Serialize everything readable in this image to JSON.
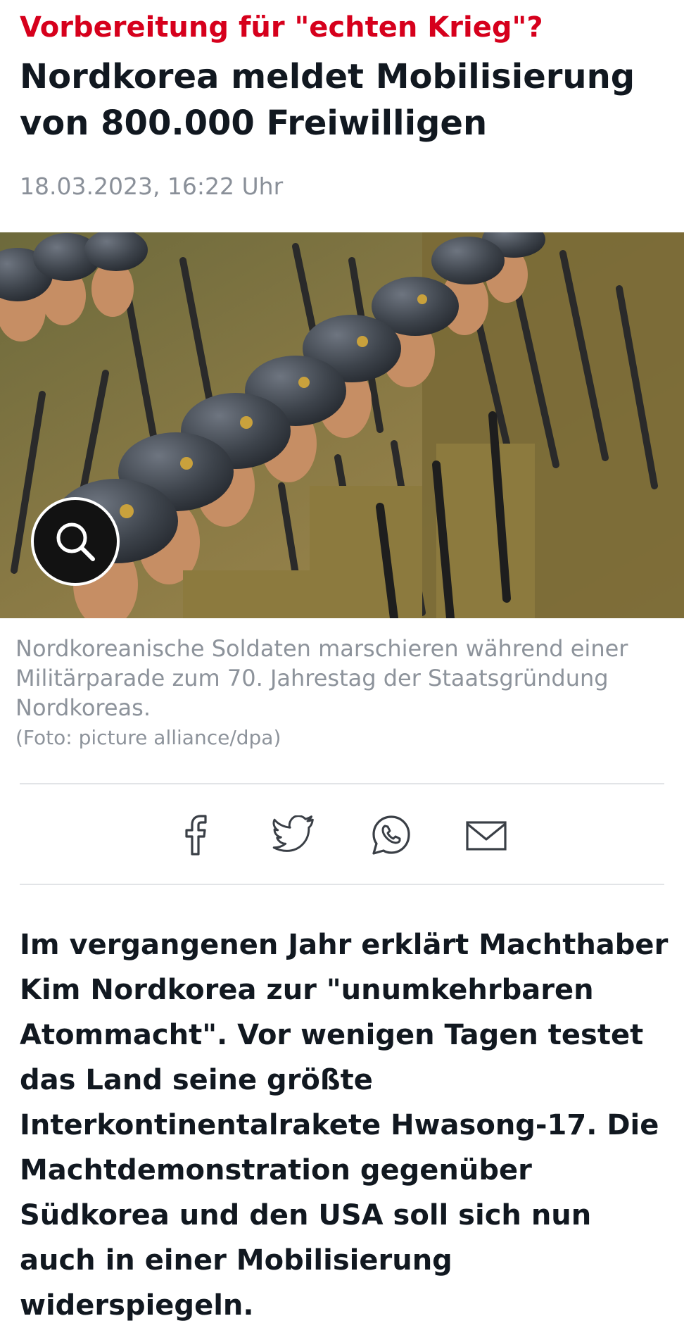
{
  "colors": {
    "accent": "#d6001c",
    "text": "#111820",
    "muted": "#8d939b"
  },
  "article": {
    "kicker": "Vorbereitung für \"echten Krieg\"?",
    "headline": "Nordkorea meldet Mobilisierung von 800.000 Freiwilligen",
    "timestamp": "18.03.2023, 16:22 Uhr"
  },
  "hero": {
    "image": "soldiers-marching-photo",
    "zoom_icon": "magnifier-icon"
  },
  "caption": {
    "text": "Nordkoreanische Soldaten marschieren während einer Militärparade zum 70. Jahrestag der Staatsgründung Nordkoreas.",
    "credit": "(Foto: picture alliance/dpa)"
  },
  "share": {
    "icons": [
      "facebook-icon",
      "twitter-icon",
      "whatsapp-icon",
      "email-icon"
    ]
  },
  "lead": "Im vergangenen Jahr erklärt Machthaber Kim Nordkorea zur \"unumkehrbaren Atommacht\". Vor wenigen Tagen testet das Land seine größte Interkontinentalrakete Hwasong-17. Die Machtdemonstration gegenüber Südkorea und den USA soll sich nun auch in einer Mobilisierung widerspiegeln."
}
